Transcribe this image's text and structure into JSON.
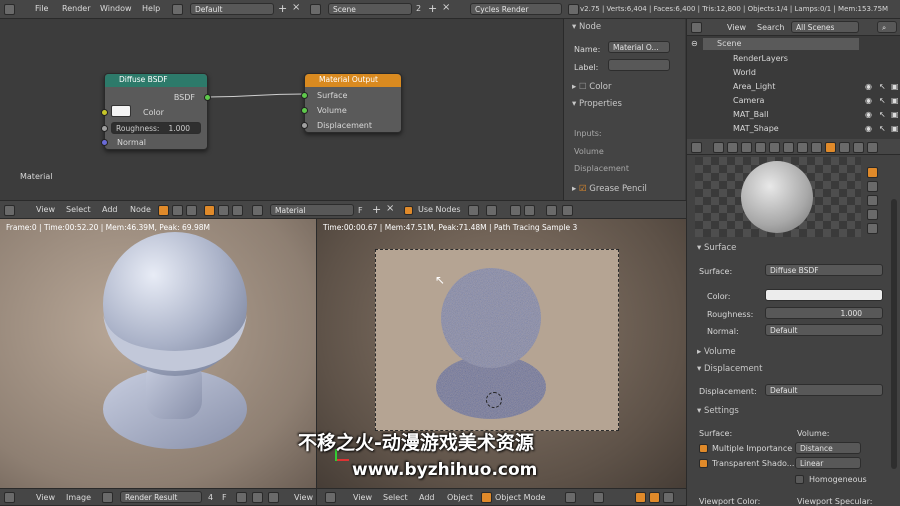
{
  "top_bar": {
    "menus": [
      "File",
      "Render",
      "Window",
      "Help"
    ],
    "layout": "Default",
    "scene": "Scene",
    "scene_count": "2",
    "engine": "Cycles Render",
    "stats": "v2.75 | Verts:6,404 | Faces:6,400 | Tris:12,800 | Objects:1/4 | Lamps:0/1 | Mem:153.75M"
  },
  "node_editor": {
    "diffuse": {
      "title": "Diffuse BSDF",
      "out": "BSDF",
      "color_label": "Color",
      "roughness": "Roughness:",
      "roughness_val": "1.000",
      "normal": "Normal"
    },
    "output": {
      "title": "Material Output",
      "surface": "Surface",
      "volume": "Volume",
      "displacement": "Displacement"
    },
    "material_label": "Material",
    "header": {
      "menus": [
        "View",
        "Select",
        "Add",
        "Node"
      ],
      "material": "Material",
      "fake": "F",
      "use_nodes": "Use Nodes"
    }
  },
  "node_panel": {
    "node_title": "Node",
    "name_label": "Name:",
    "name_val": "Material O...",
    "label_label": "Label:",
    "color": "Color",
    "properties": "Properties",
    "inputs": "Inputs:",
    "volume": "Volume",
    "displacement": "Displacement",
    "grease": "Grease Pencil"
  },
  "outliner": {
    "menus": [
      "View",
      "Search"
    ],
    "filter": "All Scenes",
    "items": [
      "Scene",
      "RenderLayers",
      "World",
      "Area_Light",
      "Camera",
      "MAT_Ball",
      "MAT_Shape"
    ]
  },
  "properties": {
    "surface_header": "Surface",
    "surface_label": "Surface:",
    "surface_val": "Diffuse BSDF",
    "color_label": "Color:",
    "roughness_label": "Roughness:",
    "roughness_val": "1.000",
    "normal_label": "Normal:",
    "normal_val": "Default",
    "volume_header": "Volume",
    "displacement_header": "Displacement",
    "displacement_label": "Displacement:",
    "displacement_val": "Default",
    "settings_header": "Settings",
    "surface2": "Surface:",
    "volume2": "Volume:",
    "multiple_importance": "Multiple Importance",
    "distance": "Distance",
    "transparent_shadows": "Transparent Shado...",
    "linear": "Linear",
    "homogeneous": "Homogeneous",
    "viewport_color": "Viewport Color:",
    "viewport_specular": "Viewport Specular:"
  },
  "render_left": {
    "info": "Frame:0 | Time:00:52.20 | Mem:46.39M, Peak: 69.98M",
    "header": {
      "menus": [
        "View",
        "Image"
      ],
      "result": "Render Result",
      "slot": "4",
      "f": "F",
      "view": "View"
    }
  },
  "render_right": {
    "info": "Time:00:00.67 | Mem:47.51M, Peak:71.48M | Path Tracing Sample 3",
    "header": {
      "menus": [
        "View",
        "Select",
        "Add",
        "Object"
      ],
      "mode": "Object Mode"
    }
  },
  "watermark": {
    "line1": "不移之火-动漫游戏美术资源",
    "line2": "www.byzhihuo.com"
  },
  "colors": {
    "accent": "#e08a2a",
    "node_green": "#2d7a6a",
    "node_orange": "#d98a20"
  }
}
